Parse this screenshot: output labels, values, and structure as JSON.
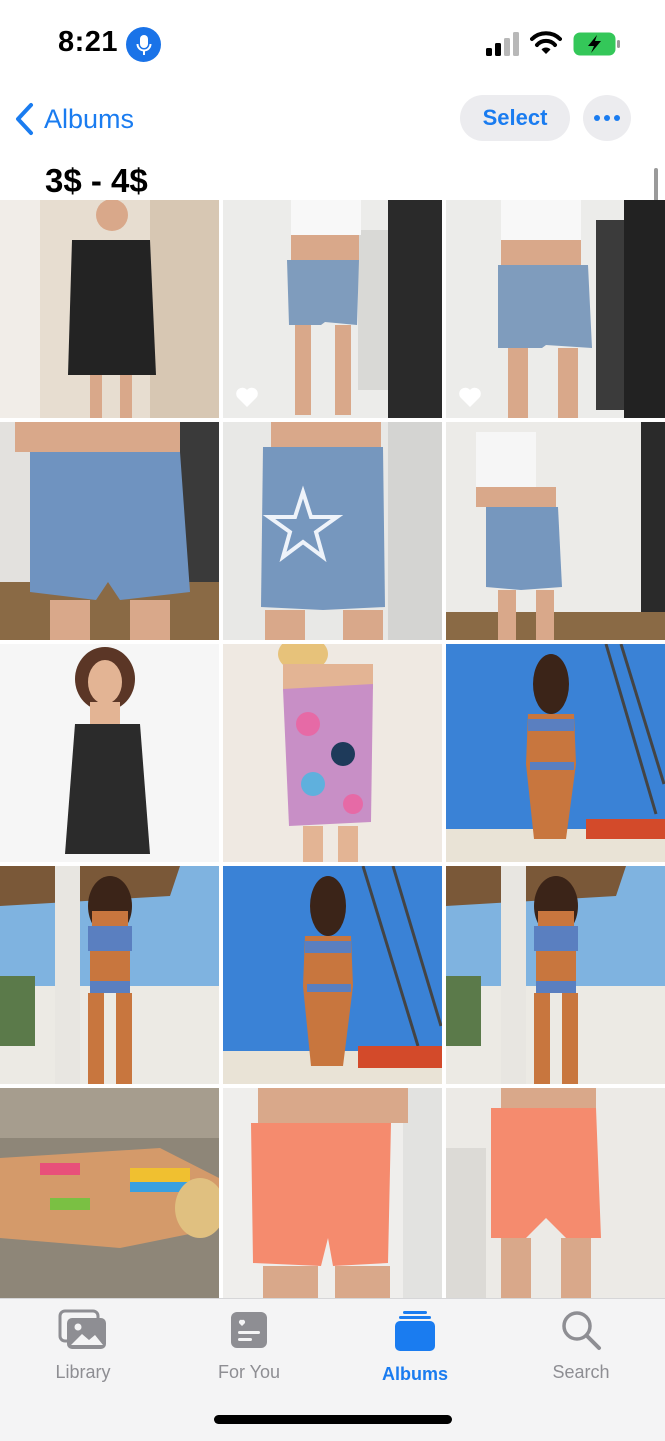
{
  "status_bar": {
    "time": "8:21"
  },
  "nav": {
    "back_label": "Albums",
    "select_label": "Select",
    "more_label": "•••"
  },
  "album": {
    "title": "3$ - 4$"
  },
  "photos": [
    {
      "desc": "black lace dress mirror selfie",
      "favorite": false
    },
    {
      "desc": "striped denim shorts mirror selfie",
      "favorite": true
    },
    {
      "desc": "striped denim shorts mirror selfie close",
      "favorite": true
    },
    {
      "desc": "frayed denim shorts front",
      "favorite": false
    },
    {
      "desc": "denim shorts with star patch back",
      "favorite": false
    },
    {
      "desc": "denim shorts with star patch back full",
      "favorite": false
    },
    {
      "desc": "black lace dress model",
      "favorite": false
    },
    {
      "desc": "floral print dress mirror selfie",
      "favorite": false
    },
    {
      "desc": "bikini beach back view",
      "favorite": false
    },
    {
      "desc": "bikini beach front pose",
      "favorite": false
    },
    {
      "desc": "bikini beach back view",
      "favorite": false
    },
    {
      "desc": "bikini beach front pose",
      "favorite": false
    },
    {
      "desc": "striped bikini lying on rock",
      "favorite": false
    },
    {
      "desc": "orange biker shorts front",
      "favorite": false
    },
    {
      "desc": "orange biker shorts back",
      "favorite": false
    }
  ],
  "tabbar": {
    "tabs": [
      {
        "label": "Library",
        "icon": "photo-library-icon",
        "active": false
      },
      {
        "label": "For You",
        "icon": "for-you-icon",
        "active": false
      },
      {
        "label": "Albums",
        "icon": "albums-icon",
        "active": true
      },
      {
        "label": "Search",
        "icon": "search-icon",
        "active": false
      }
    ]
  },
  "colors": {
    "accent": "#1a7cf0",
    "inactive": "#8e8e93",
    "battery": "#34c759"
  }
}
